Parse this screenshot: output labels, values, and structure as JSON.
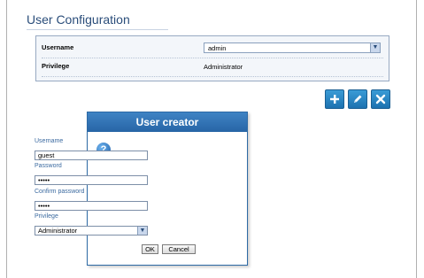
{
  "page": {
    "title": "User Configuration"
  },
  "config": {
    "username_label": "Username",
    "username_value": "admin",
    "privilege_label": "Privilege",
    "privilege_value": "Administrator"
  },
  "toolbar": {
    "add_icon": "plus-icon",
    "edit_icon": "pencil-icon",
    "delete_icon": "x-icon"
  },
  "dialog": {
    "title": "User creator",
    "help_icon": "question-icon",
    "username_label": "Username",
    "username_value": "guest",
    "password_label": "Password",
    "password_value": "•••••",
    "confirm_label": "Confirm password",
    "confirm_value": "•••••",
    "privilege_label": "Privilege",
    "privilege_value": "Administrator",
    "ok_label": "OK",
    "cancel_label": "Cancel"
  },
  "colors": {
    "accent": "#2d6aa5",
    "button_blue": "#2a86c8",
    "label_blue": "#3b6aa0"
  }
}
